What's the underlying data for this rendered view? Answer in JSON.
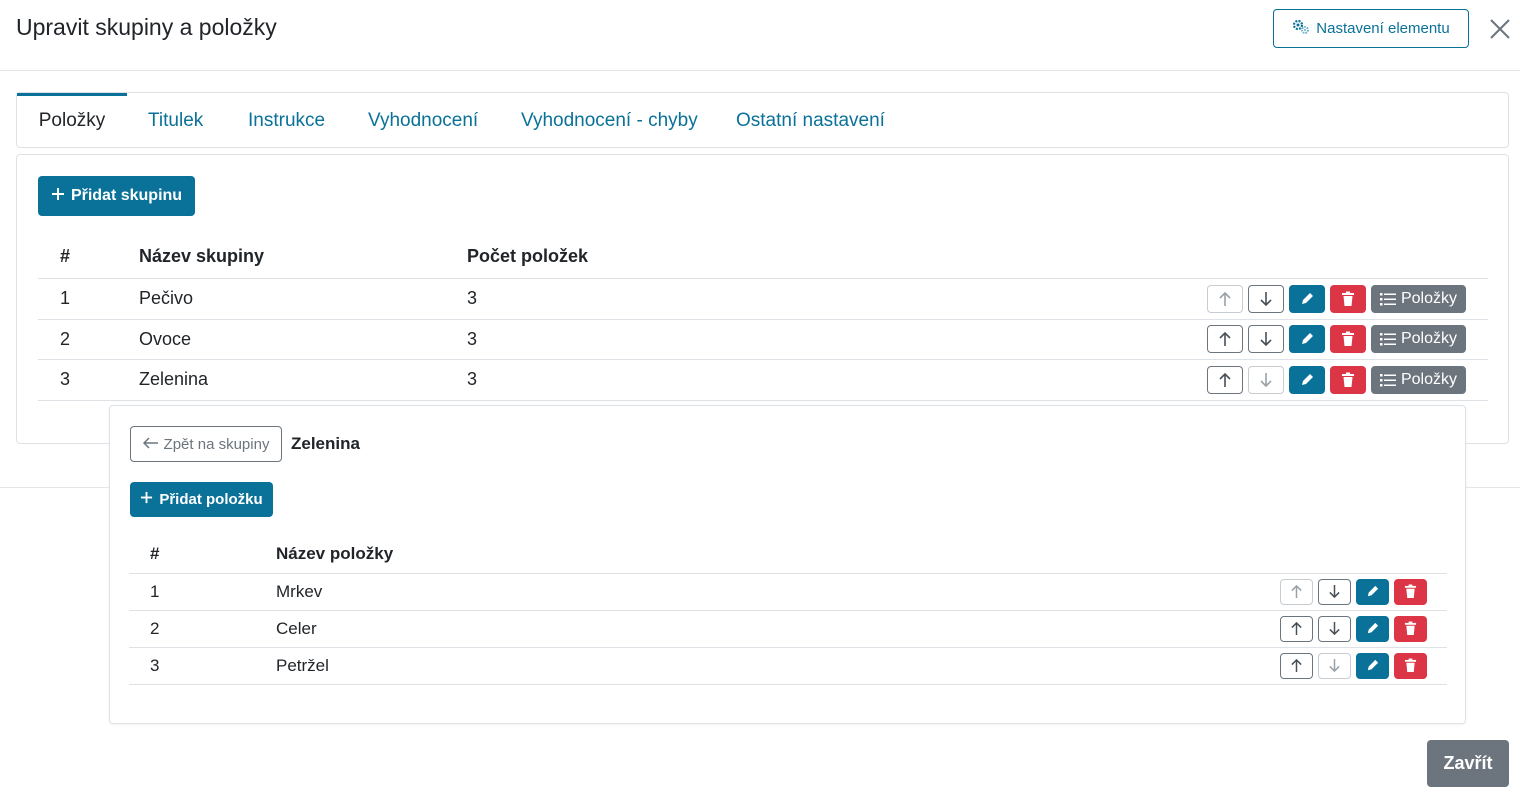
{
  "header": {
    "title": "Upravit skupiny a položky",
    "settings_label": "Nastavení elementu"
  },
  "tabs": [
    {
      "label": "Položky",
      "active": true
    },
    {
      "label": "Titulek",
      "active": false
    },
    {
      "label": "Instrukce",
      "active": false
    },
    {
      "label": "Vyhodnocení",
      "active": false
    },
    {
      "label": "Vyhodnocení - chyby",
      "active": false
    },
    {
      "label": "Ostatní nastavení",
      "active": false
    }
  ],
  "groups": {
    "add_label": "Přidat skupinu",
    "columns": [
      "#",
      "Název skupiny",
      "Počet položek"
    ],
    "items_button_label": "Položky",
    "rows": [
      {
        "num": "1",
        "name": "Pečivo",
        "count": "3"
      },
      {
        "num": "2",
        "name": "Ovoce",
        "count": "3"
      },
      {
        "num": "3",
        "name": "Zelenina",
        "count": "3"
      }
    ]
  },
  "items_panel": {
    "back_label": "Zpět na skupiny",
    "group_name": "Zelenina",
    "add_label": "Přidat položku",
    "columns": [
      "#",
      "Název položky"
    ],
    "rows": [
      {
        "num": "1",
        "name": "Mrkev"
      },
      {
        "num": "2",
        "name": "Celer"
      },
      {
        "num": "3",
        "name": "Petržel"
      }
    ]
  },
  "footer": {
    "close_label": "Zavřít"
  },
  "colors": {
    "primary": "#0a7199",
    "danger": "#dc3545",
    "secondary": "#6c757d"
  },
  "icons": [
    "gears-icon",
    "close-icon",
    "plus-icon",
    "arrow-up-icon",
    "arrow-down-icon",
    "pencil-icon",
    "trash-icon",
    "list-icon",
    "arrow-left-icon"
  ]
}
